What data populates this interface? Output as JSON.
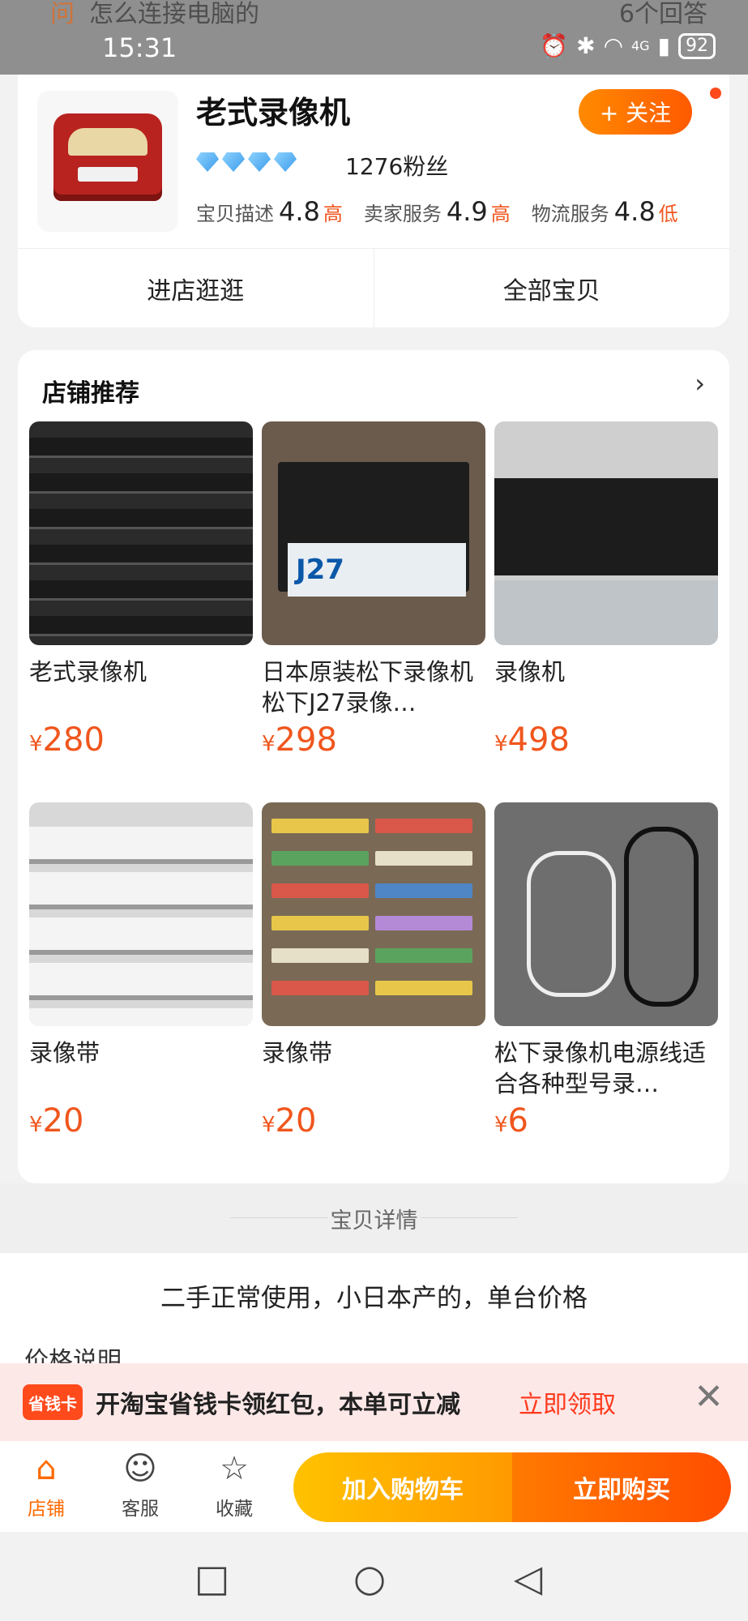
{
  "status_bar": {
    "question_badge": "问",
    "question_text": "怎么连接电脑的",
    "answers": "6个回答",
    "time": "15:31",
    "network": "4G",
    "battery": "92"
  },
  "shop": {
    "name": "老式录像机",
    "fans": "1276粉丝",
    "follow_label": "+ 关注",
    "ratings": [
      {
        "label": "宝贝描述",
        "score": "4.8",
        "level": "高"
      },
      {
        "label": "卖家服务",
        "score": "4.9",
        "level": "高"
      },
      {
        "label": "物流服务",
        "score": "4.8",
        "level": "低"
      }
    ],
    "visit_label": "进店逛逛",
    "all_items_label": "全部宝贝"
  },
  "recommend": {
    "title": "店铺推荐",
    "currency": "¥",
    "products": [
      {
        "name": "老式录像机",
        "price": "280"
      },
      {
        "name": "日本原装松下录像机 松下J27录像…",
        "price": "298"
      },
      {
        "name": "录像机",
        "price": "498"
      },
      {
        "name": "录像带",
        "price": "20"
      },
      {
        "name": "录像带",
        "price": "20"
      },
      {
        "name": "松下录像机电源线适合各种型号录…",
        "price": "6"
      }
    ],
    "j27_label": "J27"
  },
  "details": {
    "section_title": "宝贝详情",
    "description": "二手正常使用，小日本产的，单台价格",
    "price_note": "价格说明"
  },
  "promo": {
    "badge": "省钱卡",
    "text": "开淘宝省钱卡领红包，本单可立减",
    "link": "立即领取"
  },
  "bottom_bar": {
    "store": "店铺",
    "service": "客服",
    "favorite": "收藏",
    "add_cart": "加入购物车",
    "buy_now": "立即购买"
  }
}
